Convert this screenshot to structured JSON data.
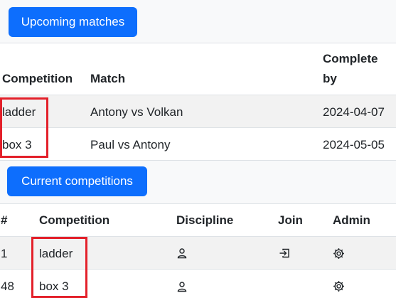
{
  "upcoming": {
    "button_label": "Upcoming matches",
    "headers": {
      "competition": "Competition",
      "match": "Match",
      "complete_by_line1": "Complete",
      "complete_by_line2": "by"
    },
    "rows": [
      {
        "competition": "ladder",
        "match": "Antony vs Volkan",
        "complete_by": "2024-04-07"
      },
      {
        "competition": "box 3",
        "match": "Paul vs Antony",
        "complete_by": "2024-05-05"
      }
    ]
  },
  "current": {
    "button_label": "Current competitions",
    "headers": {
      "num": "#",
      "competition": "Competition",
      "discipline": "Discipline",
      "join": "Join",
      "admin": "Admin"
    },
    "rows": [
      {
        "num": "1",
        "competition": "ladder",
        "discipline_icon": "person-icon",
        "join_icon": "box-arrow-in-icon",
        "admin_icon": "gear-icon"
      },
      {
        "num": "48",
        "competition": "box 3",
        "discipline_icon": "person-icon",
        "admin_icon": "gear-icon"
      }
    ]
  },
  "colors": {
    "primary": "#0d6efd",
    "highlight": "#e3202a",
    "stripe": "#f2f2f2"
  }
}
